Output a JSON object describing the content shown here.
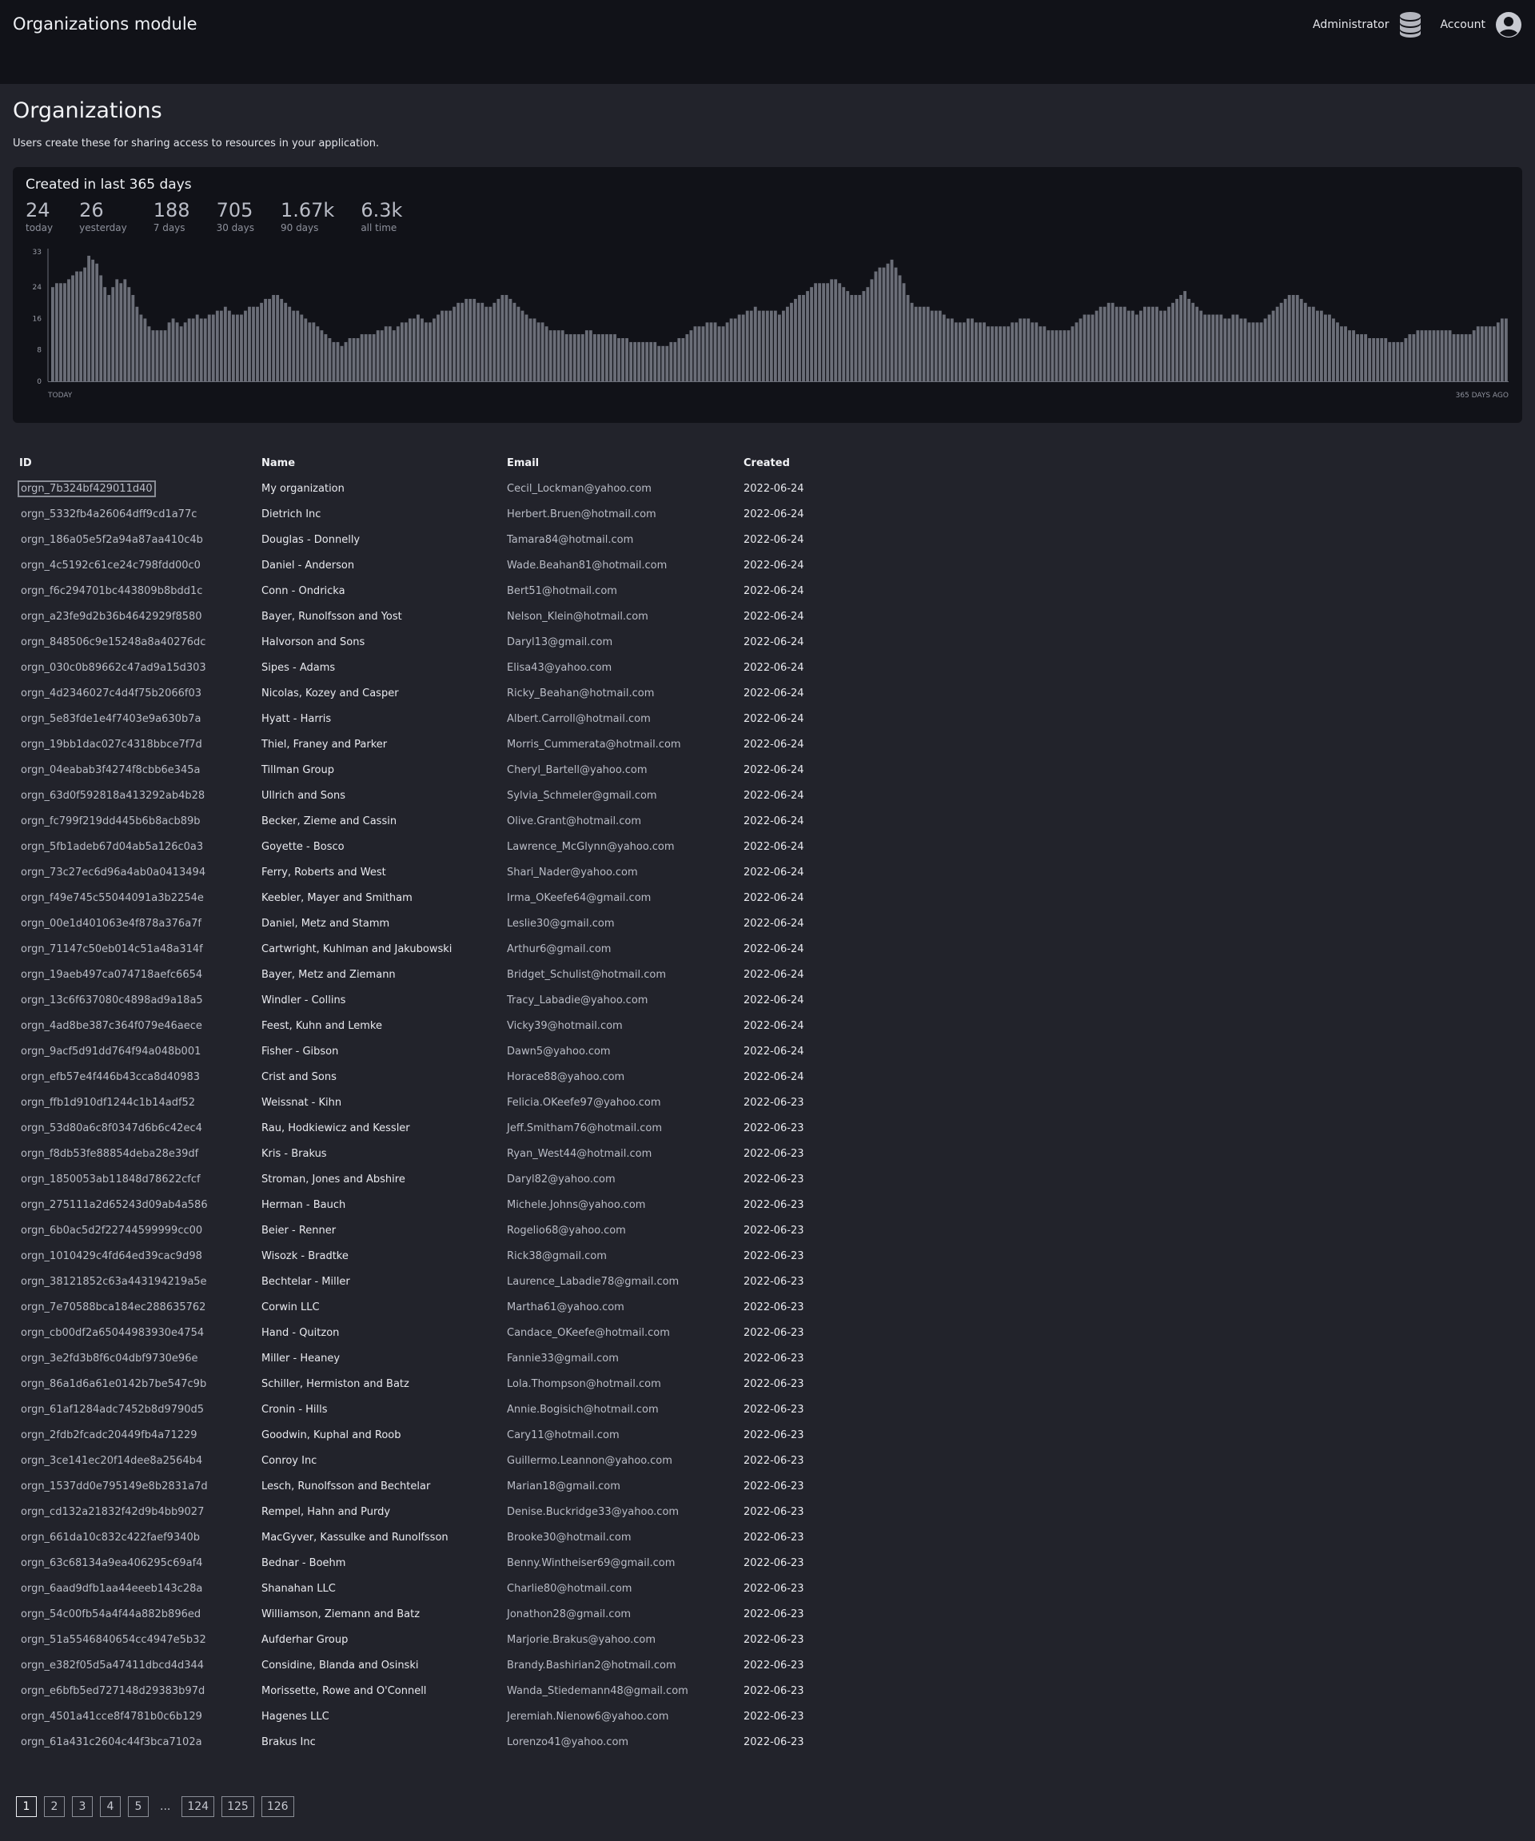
{
  "header": {
    "title": "Organizations module",
    "admin_label": "Administrator",
    "account_label": "Account"
  },
  "page": {
    "title": "Organizations",
    "subtitle": "Users create these for sharing access to resources in your application."
  },
  "stats_panel": {
    "title": "Created in last 365 days",
    "stats": [
      {
        "value": "24",
        "label": "today"
      },
      {
        "value": "26",
        "label": "yesterday"
      },
      {
        "value": "188",
        "label": "7 days"
      },
      {
        "value": "705",
        "label": "30 days"
      },
      {
        "value": "1.67k",
        "label": "90 days"
      },
      {
        "value": "6.3k",
        "label": "all time"
      }
    ]
  },
  "chart_data": {
    "type": "bar",
    "title": "Created in last 365 days",
    "xlabel_left": "TODAY",
    "xlabel_right": "365 DAYS AGO",
    "yticks": [
      0,
      8,
      16,
      24,
      33
    ],
    "ylim": [
      0,
      33
    ],
    "bar_color": "#6b6e78",
    "values": [
      24,
      25,
      25,
      25,
      26,
      27,
      28,
      28,
      29,
      32,
      31,
      30,
      27,
      24,
      22,
      24,
      26,
      25,
      26,
      24,
      22,
      19,
      17,
      16,
      14,
      13,
      13,
      13,
      13,
      15,
      16,
      15,
      14,
      15,
      16,
      16,
      17,
      16,
      16,
      17,
      17,
      18,
      18,
      19,
      18,
      17,
      17,
      17,
      18,
      19,
      19,
      19,
      20,
      21,
      21,
      22,
      22,
      21,
      20,
      19,
      18,
      18,
      17,
      16,
      15,
      15,
      14,
      13,
      12,
      11,
      10,
      10,
      9,
      10,
      11,
      11,
      11,
      12,
      12,
      12,
      12,
      13,
      13,
      14,
      14,
      13,
      14,
      15,
      15,
      16,
      16,
      17,
      16,
      15,
      15,
      16,
      17,
      18,
      18,
      18,
      19,
      20,
      20,
      21,
      21,
      21,
      20,
      20,
      19,
      19,
      20,
      21,
      22,
      22,
      21,
      20,
      19,
      18,
      17,
      16,
      16,
      15,
      15,
      14,
      13,
      13,
      13,
      13,
      12,
      12,
      12,
      12,
      12,
      13,
      13,
      12,
      12,
      12,
      12,
      12,
      12,
      11,
      11,
      11,
      10,
      10,
      10,
      10,
      10,
      10,
      10,
      9,
      9,
      9,
      10,
      10,
      11,
      11,
      12,
      13,
      14,
      14,
      14,
      15,
      15,
      15,
      14,
      14,
      15,
      16,
      16,
      17,
      17,
      18,
      18,
      19,
      18,
      18,
      18,
      18,
      18,
      17,
      18,
      19,
      20,
      21,
      22,
      22,
      23,
      24,
      25,
      25,
      25,
      25,
      26,
      26,
      25,
      24,
      23,
      22,
      22,
      22,
      23,
      24,
      26,
      28,
      29,
      29,
      30,
      31,
      29,
      27,
      25,
      22,
      20,
      19,
      19,
      19,
      19,
      18,
      18,
      18,
      17,
      16,
      16,
      15,
      15,
      15,
      16,
      16,
      15,
      15,
      15,
      14,
      14,
      14,
      14,
      14,
      14,
      15,
      15,
      16,
      16,
      16,
      15,
      15,
      14,
      14,
      13,
      13,
      13,
      13,
      13,
      13,
      14,
      15,
      16,
      17,
      17,
      17,
      18,
      19,
      19,
      20,
      20,
      19,
      19,
      19,
      18,
      18,
      17,
      18,
      19,
      19,
      19,
      19,
      18,
      18,
      19,
      20,
      21,
      22,
      23,
      21,
      20,
      19,
      18,
      17,
      17,
      17,
      17,
      17,
      16,
      16,
      17,
      17,
      16,
      16,
      15,
      15,
      15,
      15,
      16,
      17,
      18,
      19,
      20,
      21,
      22,
      22,
      22,
      21,
      20,
      19,
      19,
      18,
      18,
      17,
      17,
      16,
      15,
      14,
      14,
      13,
      13,
      12,
      12,
      12,
      11,
      11,
      11,
      11,
      11,
      10,
      10,
      10,
      10,
      11,
      12,
      12,
      13,
      13,
      13,
      13,
      13,
      13,
      13,
      13,
      13,
      12,
      12,
      12,
      12,
      12,
      13,
      14,
      14,
      14,
      14,
      14,
      15,
      16,
      16
    ]
  },
  "table": {
    "columns": [
      "ID",
      "Name",
      "Email",
      "Created"
    ],
    "rows": [
      [
        "orgn_7b324bf429011d40",
        "My organization",
        "Cecil_Lockman@yahoo.com",
        "2022-06-24"
      ],
      [
        "orgn_5332fb4a26064dff9cd1a77c",
        "Dietrich Inc",
        "Herbert.Bruen@hotmail.com",
        "2022-06-24"
      ],
      [
        "orgn_186a05e5f2a94a87aa410c4b",
        "Douglas - Donnelly",
        "Tamara84@hotmail.com",
        "2022-06-24"
      ],
      [
        "orgn_4c5192c61ce24c798fdd00c0",
        "Daniel - Anderson",
        "Wade.Beahan81@hotmail.com",
        "2022-06-24"
      ],
      [
        "orgn_f6c294701bc443809b8bdd1c",
        "Conn - Ondricka",
        "Bert51@hotmail.com",
        "2022-06-24"
      ],
      [
        "orgn_a23fe9d2b36b4642929f8580",
        "Bayer, Runolfsson and Yost",
        "Nelson_Klein@hotmail.com",
        "2022-06-24"
      ],
      [
        "orgn_848506c9e15248a8a40276dc",
        "Halvorson and Sons",
        "Daryl13@gmail.com",
        "2022-06-24"
      ],
      [
        "orgn_030c0b89662c47ad9a15d303",
        "Sipes - Adams",
        "Elisa43@yahoo.com",
        "2022-06-24"
      ],
      [
        "orgn_4d2346027c4d4f75b2066f03",
        "Nicolas, Kozey and Casper",
        "Ricky_Beahan@hotmail.com",
        "2022-06-24"
      ],
      [
        "orgn_5e83fde1e4f7403e9a630b7a",
        "Hyatt - Harris",
        "Albert.Carroll@hotmail.com",
        "2022-06-24"
      ],
      [
        "orgn_19bb1dac027c4318bbce7f7d",
        "Thiel, Franey and Parker",
        "Morris_Cummerata@hotmail.com",
        "2022-06-24"
      ],
      [
        "orgn_04eabab3f4274f8cbb6e345a",
        "Tillman Group",
        "Cheryl_Bartell@yahoo.com",
        "2022-06-24"
      ],
      [
        "orgn_63d0f592818a413292ab4b28",
        "Ullrich and Sons",
        "Sylvia_Schmeler@gmail.com",
        "2022-06-24"
      ],
      [
        "orgn_fc799f219dd445b6b8acb89b",
        "Becker, Zieme and Cassin",
        "Olive.Grant@hotmail.com",
        "2022-06-24"
      ],
      [
        "orgn_5fb1adeb67d04ab5a126c0a3",
        "Goyette - Bosco",
        "Lawrence_McGlynn@yahoo.com",
        "2022-06-24"
      ],
      [
        "orgn_73c27ec6d96a4ab0a0413494",
        "Ferry, Roberts and West",
        "Shari_Nader@yahoo.com",
        "2022-06-24"
      ],
      [
        "orgn_f49e745c55044091a3b2254e",
        "Keebler, Mayer and Smitham",
        "Irma_OKeefe64@gmail.com",
        "2022-06-24"
      ],
      [
        "orgn_00e1d401063e4f878a376a7f",
        "Daniel, Metz and Stamm",
        "Leslie30@gmail.com",
        "2022-06-24"
      ],
      [
        "orgn_71147c50eb014c51a48a314f",
        "Cartwright, Kuhlman and Jakubowski",
        "Arthur6@gmail.com",
        "2022-06-24"
      ],
      [
        "orgn_19aeb497ca074718aefc6654",
        "Bayer, Metz and Ziemann",
        "Bridget_Schulist@hotmail.com",
        "2022-06-24"
      ],
      [
        "orgn_13c6f637080c4898ad9a18a5",
        "Windler - Collins",
        "Tracy_Labadie@yahoo.com",
        "2022-06-24"
      ],
      [
        "orgn_4ad8be387c364f079e46aece",
        "Feest, Kuhn and Lemke",
        "Vicky39@hotmail.com",
        "2022-06-24"
      ],
      [
        "orgn_9acf5d91dd764f94a048b001",
        "Fisher - Gibson",
        "Dawn5@yahoo.com",
        "2022-06-24"
      ],
      [
        "orgn_efb57e4f446b43cca8d40983",
        "Crist and Sons",
        "Horace88@yahoo.com",
        "2022-06-24"
      ],
      [
        "orgn_ffb1d910df1244c1b14adf52",
        "Weissnat - Kihn",
        "Felicia.OKeefe97@yahoo.com",
        "2022-06-23"
      ],
      [
        "orgn_53d80a6c8f0347d6b6c42ec4",
        "Rau, Hodkiewicz and Kessler",
        "Jeff.Smitham76@hotmail.com",
        "2022-06-23"
      ],
      [
        "orgn_f8db53fe88854deba28e39df",
        "Kris - Brakus",
        "Ryan_West44@hotmail.com",
        "2022-06-23"
      ],
      [
        "orgn_1850053ab11848d78622cfcf",
        "Stroman, Jones and Abshire",
        "Daryl82@yahoo.com",
        "2022-06-23"
      ],
      [
        "orgn_275111a2d65243d09ab4a586",
        "Herman - Bauch",
        "Michele.Johns@yahoo.com",
        "2022-06-23"
      ],
      [
        "orgn_6b0ac5d2f22744599999cc00",
        "Beier - Renner",
        "Rogelio68@yahoo.com",
        "2022-06-23"
      ],
      [
        "orgn_1010429c4fd64ed39cac9d98",
        "Wisozk - Bradtke",
        "Rick38@gmail.com",
        "2022-06-23"
      ],
      [
        "orgn_38121852c63a443194219a5e",
        "Bechtelar - Miller",
        "Laurence_Labadie78@gmail.com",
        "2022-06-23"
      ],
      [
        "orgn_7e70588bca184ec288635762",
        "Corwin LLC",
        "Martha61@yahoo.com",
        "2022-06-23"
      ],
      [
        "orgn_cb00df2a65044983930e4754",
        "Hand - Quitzon",
        "Candace_OKeefe@hotmail.com",
        "2022-06-23"
      ],
      [
        "orgn_3e2fd3b8f6c04dbf9730e96e",
        "Miller - Heaney",
        "Fannie33@gmail.com",
        "2022-06-23"
      ],
      [
        "orgn_86a1d6a61e0142b7be547c9b",
        "Schiller, Hermiston and Batz",
        "Lola.Thompson@hotmail.com",
        "2022-06-23"
      ],
      [
        "orgn_61af1284adc7452b8d9790d5",
        "Cronin - Hills",
        "Annie.Bogisich@hotmail.com",
        "2022-06-23"
      ],
      [
        "orgn_2fdb2fcadc20449fb4a71229",
        "Goodwin, Kuphal and Roob",
        "Cary11@hotmail.com",
        "2022-06-23"
      ],
      [
        "orgn_3ce141ec20f14dee8a2564b4",
        "Conroy Inc",
        "Guillermo.Leannon@yahoo.com",
        "2022-06-23"
      ],
      [
        "orgn_1537dd0e795149e8b2831a7d",
        "Lesch, Runolfsson and Bechtelar",
        "Marian18@gmail.com",
        "2022-06-23"
      ],
      [
        "orgn_cd132a21832f42d9b4bb9027",
        "Rempel, Hahn and Purdy",
        "Denise.Buckridge33@yahoo.com",
        "2022-06-23"
      ],
      [
        "orgn_661da10c832c422faef9340b",
        "MacGyver, Kassulke and Runolfsson",
        "Brooke30@hotmail.com",
        "2022-06-23"
      ],
      [
        "orgn_63c68134a9ea406295c69af4",
        "Bednar - Boehm",
        "Benny.Wintheiser69@gmail.com",
        "2022-06-23"
      ],
      [
        "orgn_6aad9dfb1aa44eeeb143c28a",
        "Shanahan LLC",
        "Charlie80@hotmail.com",
        "2022-06-23"
      ],
      [
        "orgn_54c00fb54a4f44a882b896ed",
        "Williamson, Ziemann and Batz",
        "Jonathon28@gmail.com",
        "2022-06-23"
      ],
      [
        "orgn_51a5546840654cc4947e5b32",
        "Aufderhar Group",
        "Marjorie.Brakus@yahoo.com",
        "2022-06-23"
      ],
      [
        "orgn_e382f05d5a47411dbcd4d344",
        "Considine, Blanda and Osinski",
        "Brandy.Bashirian2@hotmail.com",
        "2022-06-23"
      ],
      [
        "orgn_e6bfb5ed727148d29383b97d",
        "Morissette, Rowe and O'Connell",
        "Wanda_Stiedemann48@gmail.com",
        "2022-06-23"
      ],
      [
        "orgn_4501a41cce8f4781b0c6b129",
        "Hagenes LLC",
        "Jeremiah.Nienow6@yahoo.com",
        "2022-06-23"
      ],
      [
        "orgn_61a431c2604c44f3bca7102a",
        "Brakus Inc",
        "Lorenzo41@yahoo.com",
        "2022-06-23"
      ]
    ]
  },
  "pagination": {
    "pages": [
      "1",
      "2",
      "3",
      "4",
      "5",
      "124",
      "125",
      "126"
    ],
    "ellipsis": "...",
    "current": "1"
  }
}
